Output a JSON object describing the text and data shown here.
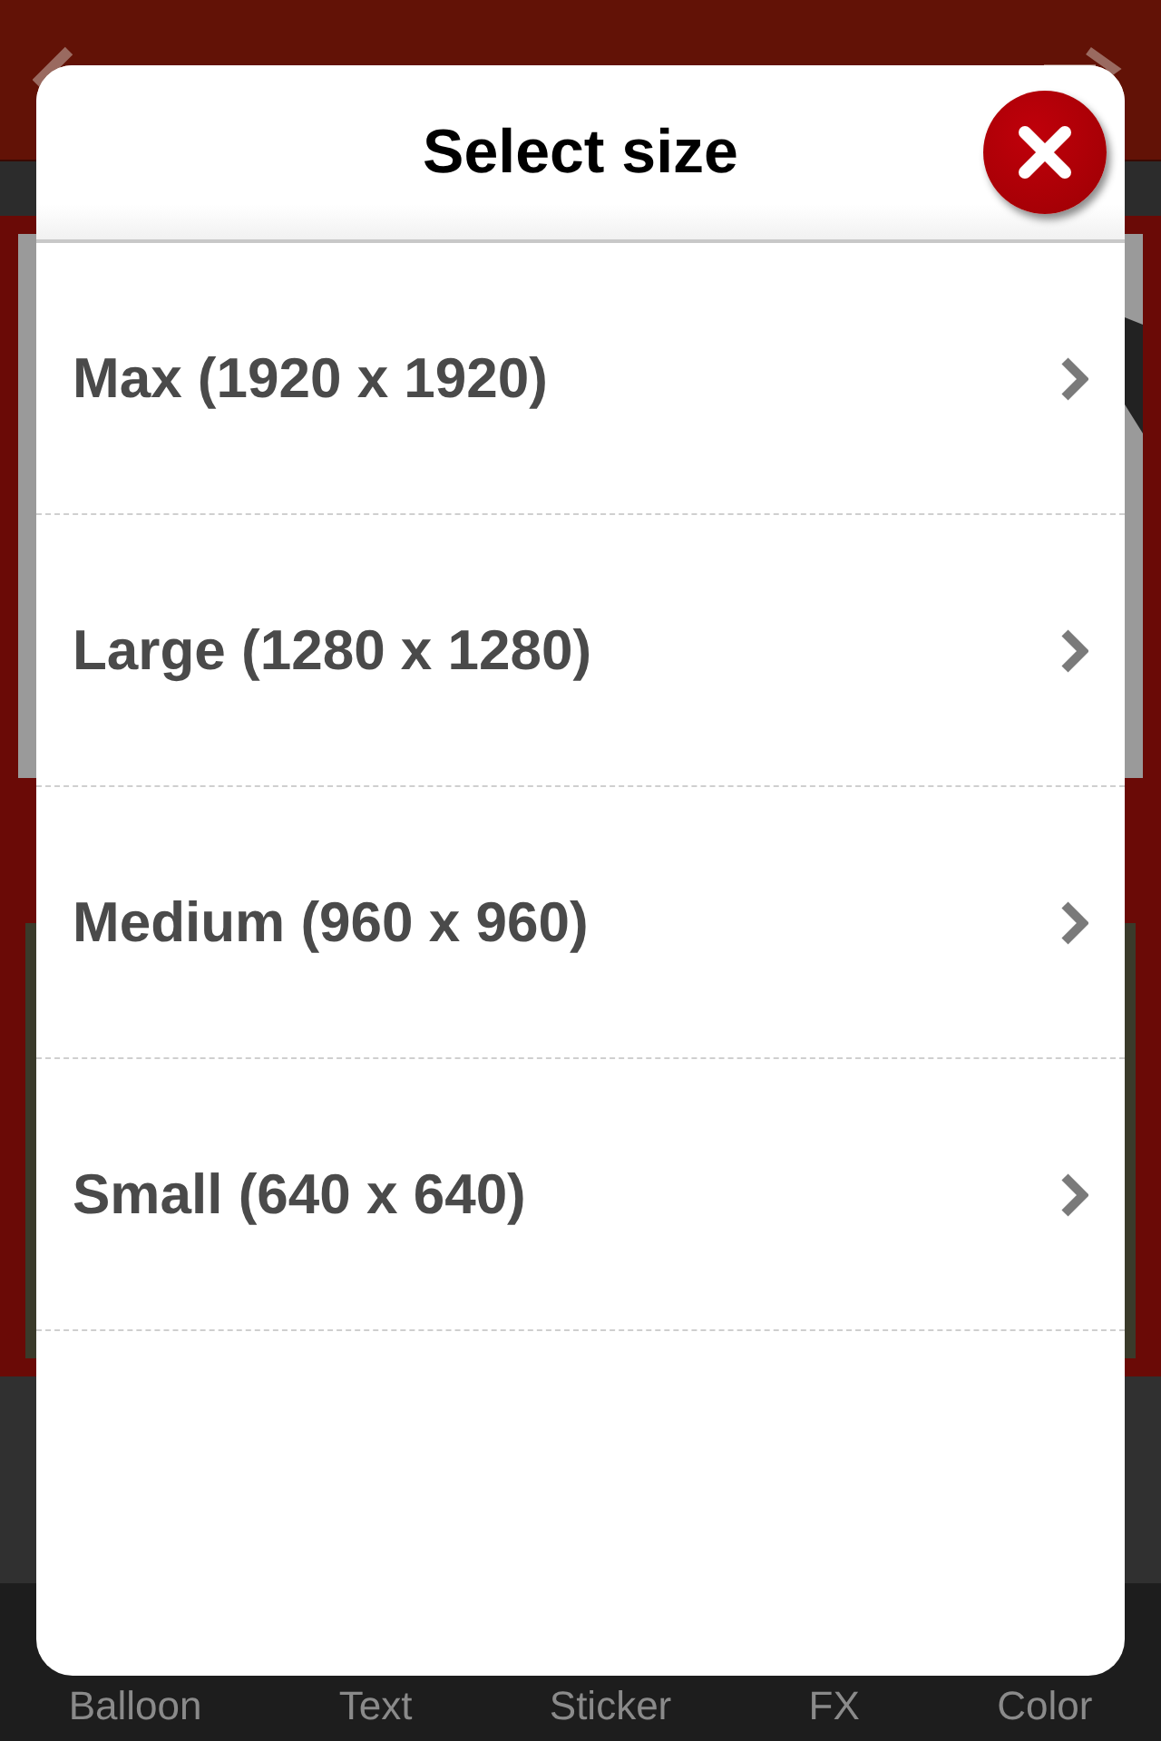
{
  "dialog": {
    "title": "Select size",
    "options": [
      {
        "label": "Max (1920 x 1920)"
      },
      {
        "label": "Large (1280 x 1280)"
      },
      {
        "label": "Medium (960 x 960)"
      },
      {
        "label": "Small (640 x 640)"
      }
    ]
  },
  "toolbar": {
    "items": [
      {
        "label": "Balloon"
      },
      {
        "label": "Text"
      },
      {
        "label": "Sticker"
      },
      {
        "label": "FX"
      },
      {
        "label": "Color"
      }
    ]
  }
}
